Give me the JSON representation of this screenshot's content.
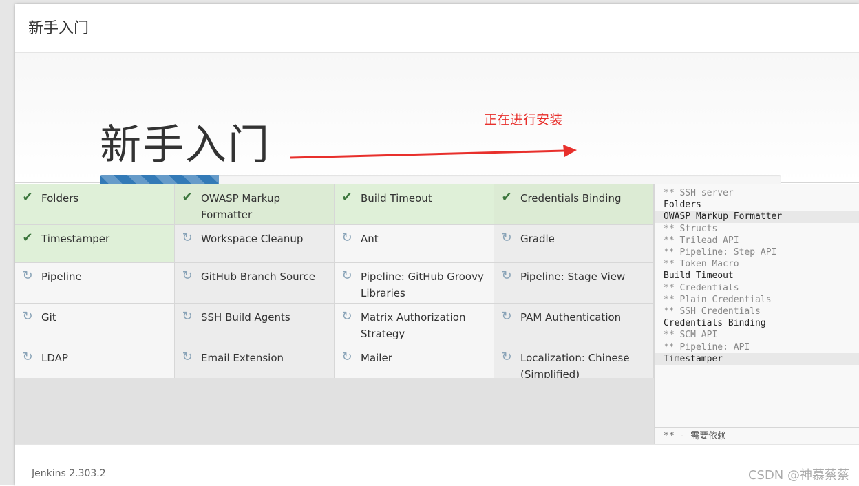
{
  "header": {
    "title": "新手入门"
  },
  "hero": {
    "title": "新手入门",
    "annotation": "正在进行安装",
    "progress": 0.175
  },
  "colors": {
    "done_bg": "#dff0d8",
    "progress": "#337ab7",
    "annotation": "#e8302c"
  },
  "plugins": [
    {
      "name": "Folders",
      "status": "done"
    },
    {
      "name": "OWASP Markup Formatter",
      "status": "done"
    },
    {
      "name": "Build Timeout",
      "status": "done"
    },
    {
      "name": "Credentials Binding",
      "status": "done"
    },
    {
      "name": "Timestamper",
      "status": "done"
    },
    {
      "name": "Workspace Cleanup",
      "status": "pending"
    },
    {
      "name": "Ant",
      "status": "pending"
    },
    {
      "name": "Gradle",
      "status": "pending"
    },
    {
      "name": "Pipeline",
      "status": "pending"
    },
    {
      "name": "GitHub Branch Source",
      "status": "pending"
    },
    {
      "name": "Pipeline: GitHub Groovy Libraries",
      "status": "pending"
    },
    {
      "name": "Pipeline: Stage View",
      "status": "pending"
    },
    {
      "name": "Git",
      "status": "pending"
    },
    {
      "name": "SSH Build Agents",
      "status": "pending"
    },
    {
      "name": "Matrix Authorization Strategy",
      "status": "pending"
    },
    {
      "name": "PAM Authentication",
      "status": "pending"
    },
    {
      "name": "LDAP",
      "status": "pending"
    },
    {
      "name": "Email Extension",
      "status": "pending"
    },
    {
      "name": "Mailer",
      "status": "pending"
    },
    {
      "name": "Localization: Chinese (Simplified)",
      "status": "pending"
    }
  ],
  "log": {
    "lines": [
      "** SSH server",
      "Folders",
      "OWASP Markup Formatter",
      "** Structs",
      "** Trilead API",
      "** Pipeline: Step API",
      "** Token Macro",
      "Build Timeout",
      "** Credentials",
      "** Plain Credentials",
      "** SSH Credentials",
      "Credentials Binding",
      "** SCM API",
      "** Pipeline: API",
      "Timestamper"
    ],
    "footer": "** - 需要依赖"
  },
  "footer": {
    "version": "Jenkins 2.303.2",
    "watermark": "CSDN @神慕蔡蔡"
  }
}
